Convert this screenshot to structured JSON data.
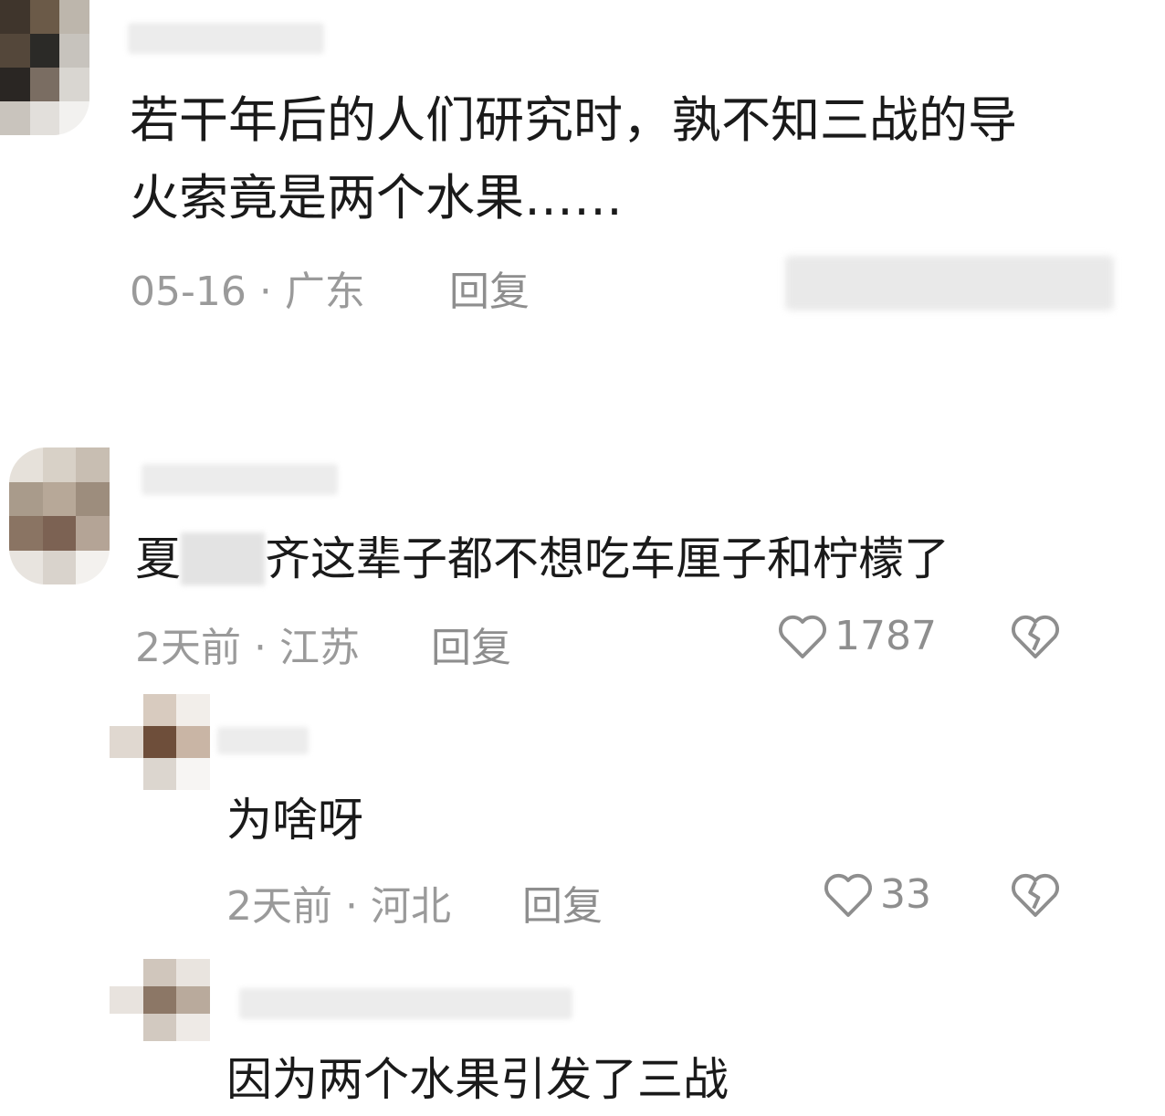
{
  "comments": [
    {
      "text_lines": [
        "若干年后的人们研究时，孰不知三战的导",
        "火索竟是两个水果……"
      ],
      "meta": "05-16 · 广东",
      "reply_label": "回复"
    },
    {
      "text_prefix": "夏",
      "text_suffix": "齐这辈子都不想吃车厘子和柠檬了",
      "meta": "2天前 · 江苏",
      "reply_label": "回复",
      "likes": "1787"
    },
    {
      "text": "为啥呀",
      "meta": "2天前 · 河北",
      "reply_label": "回复",
      "likes": "33"
    },
    {
      "text": "因为两个水果引发了三战"
    }
  ],
  "icons": {
    "like": "heart-outline-icon",
    "dislike": "broken-heart-icon"
  },
  "colors": {
    "text": "#1a1a1a",
    "meta": "#9a9a9a",
    "icon": "#8e8e8e"
  }
}
